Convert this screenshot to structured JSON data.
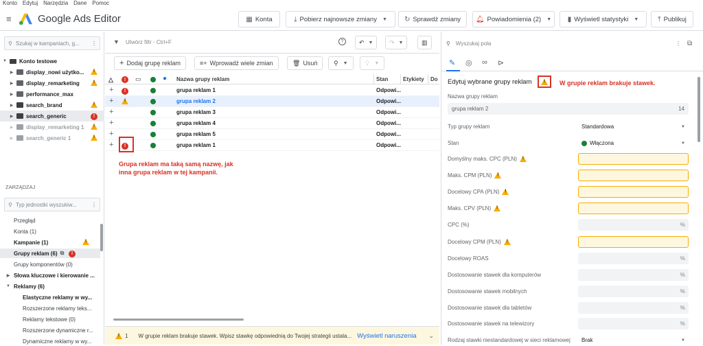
{
  "menu": [
    "Konto",
    "Edytuj",
    "Narzędzia",
    "Dane",
    "Pomoc"
  ],
  "app_title": "Google Ads Editor",
  "toolbar": {
    "konta": "Konta",
    "pobierz": "Pobierz najnowsze zmiany",
    "sprawdz": "Sprawdź zmiany",
    "powiadomienia": "Powiadomienia (2)",
    "statystyki": "Wyświetl statystyki",
    "publikuj": "Publikuj"
  },
  "left": {
    "search_placeholder": "Szukaj w kampaniach, g...",
    "account": "Konto testowe",
    "campaigns": [
      {
        "name": "display_nowi użytko...",
        "status": "warn"
      },
      {
        "name": "display_remarketing",
        "status": "warn"
      },
      {
        "name": "performance_max",
        "status": ""
      },
      {
        "name": "search_brand",
        "status": "warn"
      },
      {
        "name": "search_generic",
        "status": "err"
      },
      {
        "name": "display_remarketing 1",
        "status": "warn"
      },
      {
        "name": "search_generic 1",
        "status": "warn"
      }
    ],
    "manage_label": "ZARZĄDZAJ",
    "manage_search": "Typ jednostki wyszukiw...",
    "manage_items": [
      "Przegląd",
      "Konta (1)",
      "Kampanie (1)",
      "Grupy reklam (6)",
      "Grupy komponentów (0)",
      "Słowa kluczowe i kierowanie ...",
      "Reklamy (6)",
      "Elastyczne reklamy w wy...",
      "Rozszerzone reklamy teks...",
      "Reklamy tekstowe (0)",
      "Rozszerzone dynamiczne r...",
      "Dynamiczne reklamy w wy..."
    ]
  },
  "center": {
    "filter_placeholder": "Utwórz filtr - Ctrl+F",
    "add_btn": "Dodaj grupę reklam",
    "multi_btn": "Wprowadź wiele zmian",
    "delete_btn": "Usuń",
    "columns": {
      "name": "Nazwa grupy reklam",
      "stan": "Stan",
      "etykiety": "Etykiety",
      "do": "Do"
    },
    "rows": [
      {
        "status": "err",
        "name": "grupa reklam 1",
        "stan": "Odpowi..."
      },
      {
        "status": "warn",
        "name": "grupa reklam 2",
        "stan": "Odpowi..."
      },
      {
        "status": "",
        "name": "grupa reklam 3",
        "stan": "Odpowi..."
      },
      {
        "status": "",
        "name": "grupa reklam 4",
        "stan": "Odpowi..."
      },
      {
        "status": "",
        "name": "grupa reklam 5",
        "stan": "Odpowi..."
      },
      {
        "status": "err",
        "name": "grupa reklam 1",
        "stan": "Odpowi..."
      }
    ],
    "annotation_line1": "Grupa reklam ma taką samą nazwę, jak",
    "annotation_line2": "inna grupa reklam w tej kampanii.",
    "bottom_count": "1",
    "bottom_text": "W grupie reklam brakuje stawek. Wpisz stawkę odpowiednią do Twojej strategii ustala...",
    "bottom_link": "Wyświetl naruszenia"
  },
  "right": {
    "search_placeholder": "Wyszukaj pola",
    "title": "Edytuj wybrane grupy reklam",
    "annotation": "W grupie reklam brakuje stawek.",
    "name_label": "Nazwa grupy reklam",
    "name_value": "grupa reklam 2",
    "name_count": "14",
    "fields": [
      {
        "label": "Typ grupy reklam",
        "value": "Standardowa",
        "kind": "select",
        "warn": false
      },
      {
        "label": "Stan",
        "value": "Włączona",
        "kind": "status",
        "warn": false
      },
      {
        "label": "Domyślny maks. CPC (PLN)",
        "value": "",
        "kind": "hl",
        "warn": true
      },
      {
        "label": "Maks. CPM (PLN)",
        "value": "",
        "kind": "hl",
        "warn": true
      },
      {
        "label": "Docelowy CPA (PLN)",
        "value": "",
        "kind": "hl",
        "warn": true
      },
      {
        "label": "Maks. CPV (PLN)",
        "value": "",
        "kind": "hl",
        "warn": true
      },
      {
        "label": "CPC (%)",
        "value": "%",
        "kind": "plain",
        "warn": false
      },
      {
        "label": "Docelowy CPM (PLN)",
        "value": "",
        "kind": "hl",
        "warn": true
      },
      {
        "label": "Docelowy ROAS",
        "value": "%",
        "kind": "plain",
        "warn": false
      },
      {
        "label": "Dostosowanie stawek dla komputerów",
        "value": "%",
        "kind": "plain",
        "warn": false
      },
      {
        "label": "Dostosowanie stawek mobilnych",
        "value": "%",
        "kind": "plain",
        "warn": false
      },
      {
        "label": "Dostosowanie stawek dla tabletów",
        "value": "%",
        "kind": "plain",
        "warn": false
      },
      {
        "label": "Dostosowanie stawek na telewizory",
        "value": "%",
        "kind": "plain",
        "warn": false
      },
      {
        "label": "Rodzaj stawki niestandardowej w sieci reklamowej",
        "value": "Brak",
        "kind": "select",
        "warn": false
      }
    ]
  }
}
